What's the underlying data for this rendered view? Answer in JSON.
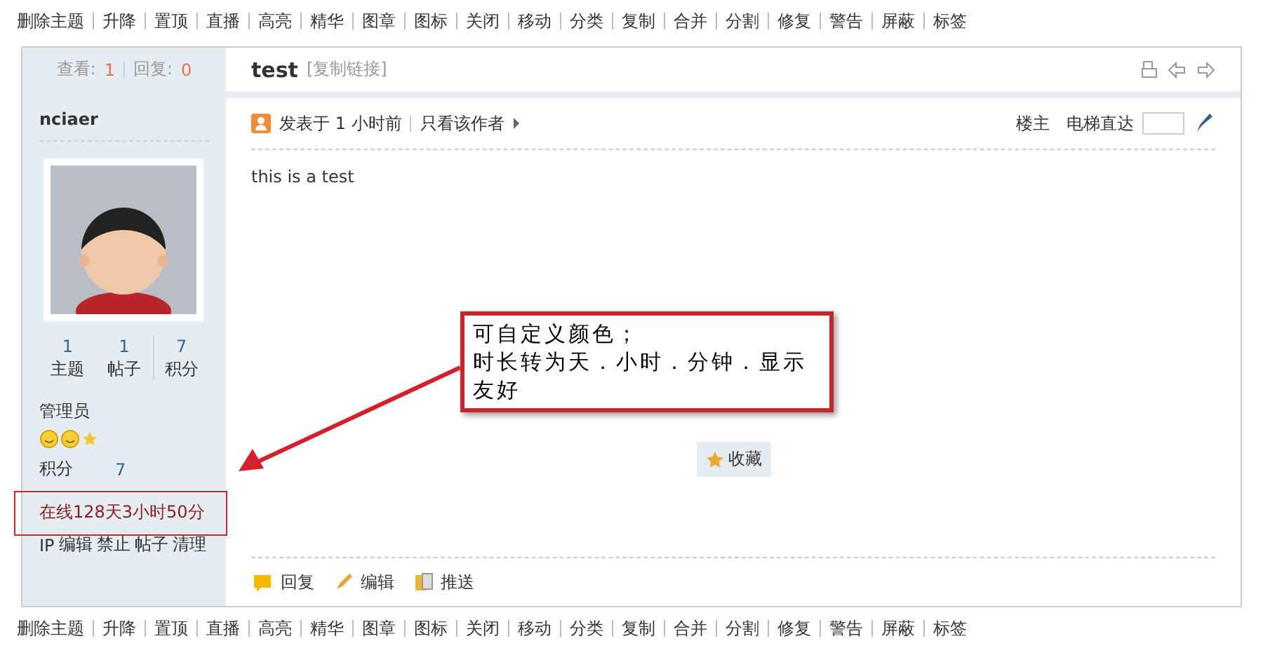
{
  "mod_toolbar_top": [
    "删除主题",
    "升降",
    "置顶",
    "直播",
    "高亮",
    "精华",
    "图章",
    "图标",
    "关闭",
    "移动",
    "分类",
    "复制",
    "合并",
    "分割",
    "修复",
    "警告",
    "屏蔽",
    "标签"
  ],
  "thread_stats": {
    "views_label": "查看:",
    "views": "1",
    "replies_label": "回复:",
    "replies": "0"
  },
  "thread": {
    "title": "test",
    "copy_link": "[复制链接]"
  },
  "author": {
    "name": "nciaer",
    "stats": [
      {
        "value": "1",
        "label": "主题"
      },
      {
        "value": "1",
        "label": "帖子"
      },
      {
        "value": "7",
        "label": "积分"
      }
    ],
    "group": "管理员",
    "points_label": "积分",
    "points": "7",
    "online": "在线128天3小时50分",
    "admin_links": [
      "IP",
      "编辑",
      "禁止",
      "帖子",
      "清理"
    ]
  },
  "post": {
    "posted": "发表于 1 小时前",
    "only_author": "只看该作者",
    "floor": "楼主",
    "jump_label": "电梯直达",
    "content": "this is a test",
    "favorite": "收藏",
    "actions": [
      {
        "kind": "reply",
        "label": "回复"
      },
      {
        "kind": "edit",
        "label": "编辑"
      },
      {
        "kind": "push",
        "label": "推送"
      }
    ]
  },
  "annotation": {
    "lines": [
      "可自定义颜色；",
      "时长转为天．小时．分钟．显示友好"
    ]
  },
  "mod_toolbar_bottom": [
    "删除主题",
    "升降",
    "置顶",
    "直播",
    "高亮",
    "精华",
    "图章",
    "图标",
    "关闭",
    "移动",
    "分类",
    "复制",
    "合并",
    "分割",
    "修复",
    "警告",
    "屏蔽",
    "标签"
  ]
}
